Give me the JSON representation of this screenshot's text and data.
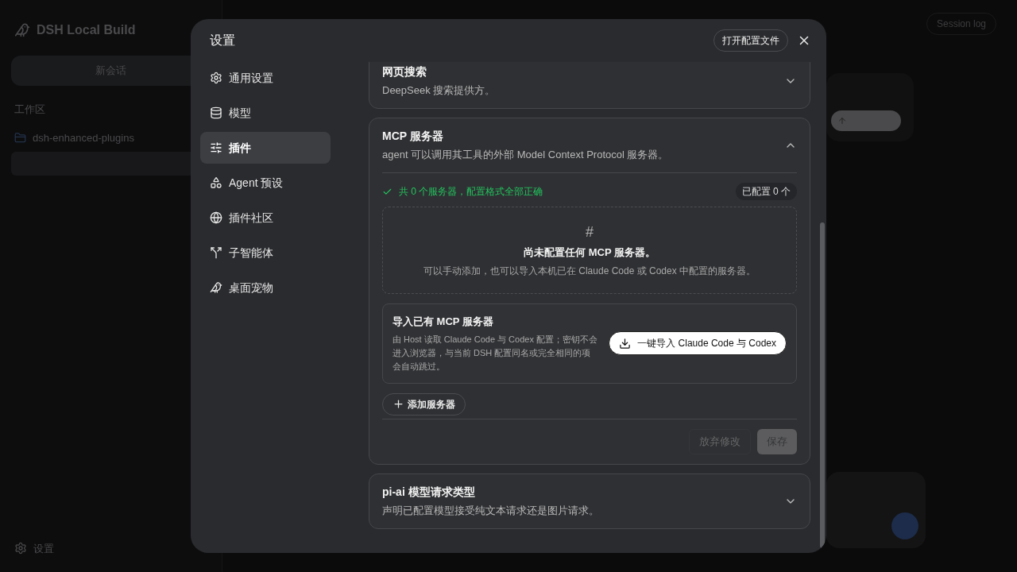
{
  "backdrop": {
    "app_title": "DSH Local Build",
    "new_chat": "新会话",
    "workspace_label": "工作区",
    "project": "dsh-enhanced-plugins",
    "settings_label": "设置",
    "session_log": "Session log"
  },
  "modal": {
    "title": "设置",
    "open_config_button": "打开配置文件",
    "nav": [
      {
        "label": "通用设置",
        "selected": false
      },
      {
        "label": "模型",
        "selected": false
      },
      {
        "label": "插件",
        "selected": true
      },
      {
        "label": "Agent 预设",
        "selected": false
      },
      {
        "label": "插件社区",
        "selected": false
      },
      {
        "label": "子智能体",
        "selected": false
      },
      {
        "label": "桌面宠物",
        "selected": false
      }
    ],
    "sections": [
      {
        "title": "网页搜索",
        "description": "DeepSeek 搜索提供方。",
        "expanded": false
      },
      {
        "title": "MCP 服务器",
        "description": "agent 可以调用其工具的外部 Model Context Protocol 服务器。",
        "expanded": true,
        "status": "共 0 个服务器，配置格式全部正确",
        "configured_badge": "已配置 0 个",
        "empty_state": {
          "symbol": "#",
          "title": "尚未配置任何 MCP 服务器。",
          "description": "可以手动添加，也可以导入本机已在 Claude Code 或 Codex 中配置的服务器。"
        },
        "import": {
          "title": "导入已有 MCP 服务器",
          "description": "由 Host 读取 Claude Code 与 Codex 配置；密钥不会进入浏览器，与当前 DSH 配置同名或完全相同的项会自动跳过。",
          "button": "一键导入 Claude Code 与 Codex"
        },
        "add_button": "添加服务器",
        "discard_button": {
          "label": "放弃修改",
          "disabled": true
        },
        "save_button": {
          "label": "保存",
          "disabled": true
        }
      },
      {
        "title": "pi-ai 模型请求类型",
        "description": "声明已配置模型接受纯文本请求还是图片请求。",
        "expanded": false
      }
    ]
  }
}
